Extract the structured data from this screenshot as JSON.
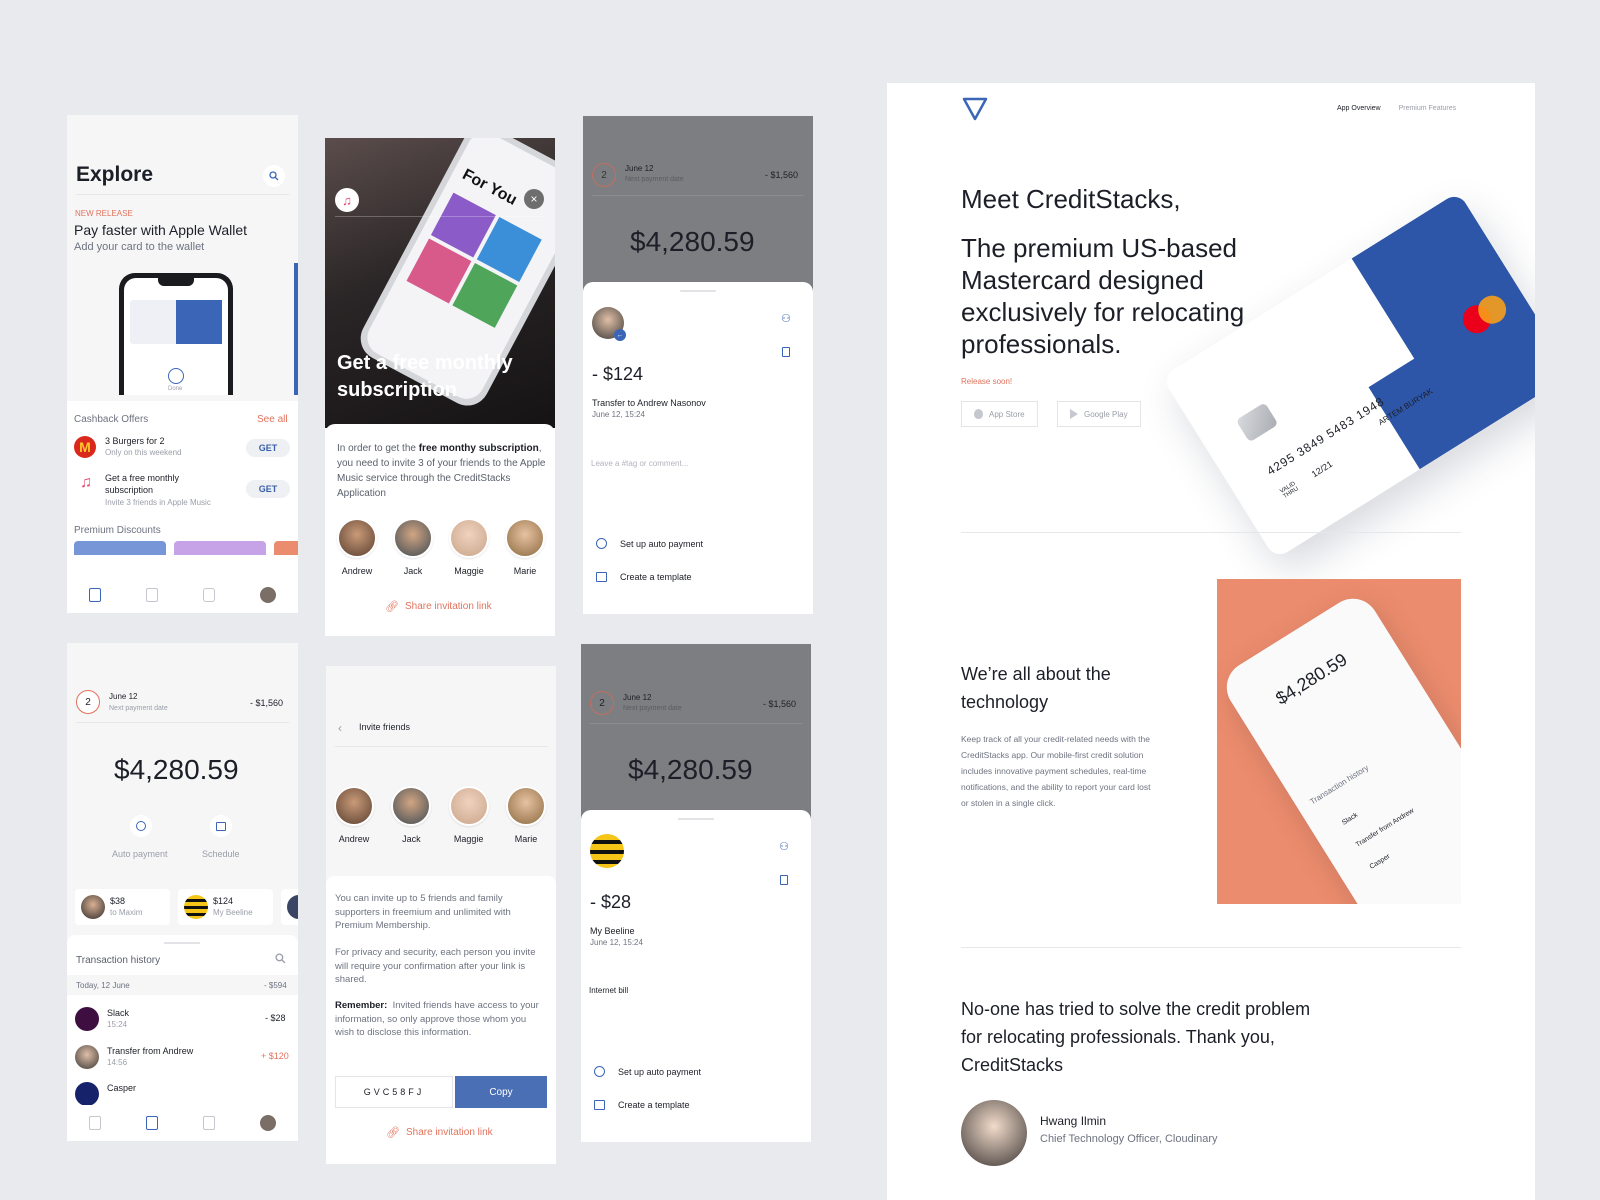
{
  "screen1": {
    "title": "Explore",
    "tag": "NEW RELEASE",
    "promo_title": "Pay faster with Apple Wallet",
    "promo_sub": "Add your card to the wallet",
    "phone_done": "Done",
    "cashback_title": "Cashback Offers",
    "see_all": "See all",
    "offers": [
      {
        "title": "3 Burgers for 2",
        "sub": "Only on this weekend",
        "btn": "GET"
      },
      {
        "title": "Get a free monthly subscription",
        "sub": "Invite 3 friends in Apple Music",
        "btn": "GET"
      }
    ],
    "discounts_title": "Premium Discounts"
  },
  "screen2": {
    "hero_title": "Get a free monthly subscription",
    "phone_screen_text": "For You",
    "body_pre": "In order to get the ",
    "body_bold1": "free monthy subscription",
    "body_post": ", you need to invite 3 of your friends to the Apple Music service through the CreditStacks Application",
    "friends": [
      "Andrew",
      "Jack",
      "Maggie",
      "Marie"
    ],
    "share": "Share invitation link"
  },
  "screen3": {
    "num": "2",
    "date": "June 12",
    "date_sub": "Next payment date",
    "due": "- $1,560",
    "balance": "$4,280.59",
    "amount": "- $124",
    "transfer": "Transfer to Andrew Nasonov",
    "transfer_date": "June 12, 15:24",
    "comment_placeholder": "Leave a #tag or comment...",
    "auto": "Set up auto payment",
    "template": "Create a template"
  },
  "screen4": {
    "num": "2",
    "date": "June 12",
    "date_sub": "Next payment date",
    "due": "- $1,560",
    "balance": "$4,280.59",
    "actions": [
      "Auto payment",
      "Schedule"
    ],
    "quick": [
      {
        "amount": "$38",
        "to": "to Maxim"
      },
      {
        "amount": "$124",
        "to": "My Beeline"
      }
    ],
    "history_title": "Transaction history",
    "day": "Today, 12 June",
    "day_total": "- $594",
    "txns": [
      {
        "name": "Slack",
        "time": "15:24",
        "amount": "- $28"
      },
      {
        "name": "Transfer from Andrew",
        "time": "14:56",
        "amount": "+ $120"
      },
      {
        "name": "Casper",
        "time": "",
        "amount": ""
      }
    ]
  },
  "screen5": {
    "title": "Invite friends",
    "friends": [
      "Andrew",
      "Jack",
      "Maggie",
      "Marie"
    ],
    "p1": "You can invite up to 5 friends and family supporters in freemium and unlimited with Premium Membership.",
    "p2": "For privacy and security, each person you invite will require your confirmation after your link is shared.",
    "remember_label": "Remember:",
    "remember_text": "Invited friends have access to your information, so only approve those whom you wish to disclose this information.",
    "code": "GVC58FJ",
    "copy": "Copy",
    "share": "Share invitation link"
  },
  "screen6": {
    "num": "2",
    "date": "June 12",
    "date_sub": "Next payment date",
    "due": "- $1,560",
    "balance": "$4,280.59",
    "amount": "- $28",
    "merchant": "My Beeline",
    "merchant_date": "June 12, 15:24",
    "note": "Internet bill",
    "auto": "Set up auto payment",
    "template": "Create a template"
  },
  "landing": {
    "nav": [
      "App Overview",
      "Premium Features"
    ],
    "headline": "Meet CreditStacks,",
    "subhead": "The premium US-based Mastercard designed exclusively for relocating professionals.",
    "release": "Release soon!",
    "stores": [
      "App Store",
      "Google Play"
    ],
    "card_number": "4295 3849 5483 1948",
    "card_valid": "VALID THRU",
    "card_exp": "12/21",
    "card_name": "ARTEM BURYAK",
    "section2_title": "We’re all about the technology",
    "section2_body": "Keep track of all your credit-related needs with the CreditStacks app. Our mobile-first credit solution includes innovative payment schedules, real-time notifications, and the ability to report your card lost or stolen in a single click.",
    "phone2": {
      "balance": "$4,280.59",
      "history": "Transaction history",
      "rows": [
        "Slack",
        "Transfer from Andrew",
        "Casper"
      ]
    },
    "quote": "No-one has tried to solve the credit problem for relocating professionals. Thank you, CreditStacks",
    "author": "Hwang Ilmin",
    "author_role": "Chief Technology Officer, Cloudinary"
  },
  "colors": {
    "accent": "#3b66b8",
    "orange": "#e2735d",
    "peach": "#ec8c6e",
    "bg": "#e9eaee"
  }
}
